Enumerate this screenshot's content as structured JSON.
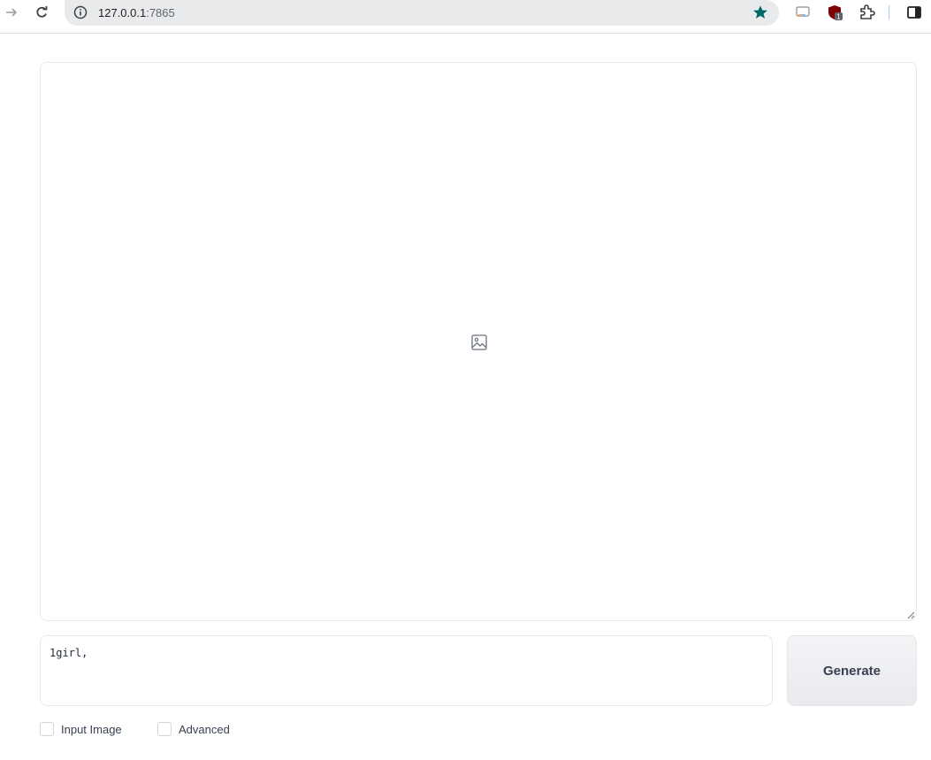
{
  "browser": {
    "url_host": "127.0.0.1",
    "url_port": ":7865"
  },
  "prompt": {
    "value": "1girl,"
  },
  "actions": {
    "generate_label": "Generate"
  },
  "options": {
    "input_image_label": "Input Image",
    "advanced_label": "Advanced"
  },
  "colors": {
    "star": "#006a6a",
    "border": "#e5e7eb",
    "button_bg": "#eceef1",
    "text": "#374151"
  },
  "icons": {
    "forward": "arrow-forward-icon",
    "reload": "reload-icon",
    "site_info": "info-icon",
    "bookmark": "star-icon",
    "placeholder": "image-icon"
  }
}
